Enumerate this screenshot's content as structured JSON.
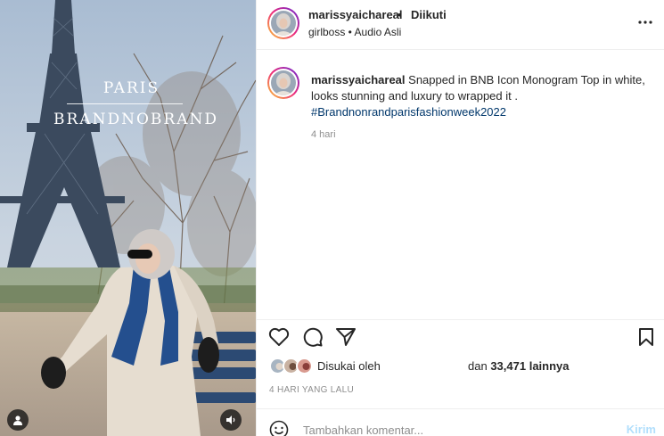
{
  "post": {
    "username": "marissyaichareal",
    "separator": "•",
    "follow_status": "Diikuti",
    "audio": "girlboss • Audio Asli",
    "more_icon": "more-horizontal-icon"
  },
  "media": {
    "overlay_city": "PARIS",
    "overlay_brand": "BRANDNOBRAND"
  },
  "caption": {
    "username": "marissyaichareal",
    "text": " Snapped in BNB Icon Monogram Top in white, looks stunning and luxury to wrapped it . ",
    "hashtag": "#Brandnonrandparisfashionweek2022",
    "time": "4 hari"
  },
  "actions": {
    "like_icon": "heart-icon",
    "comment_icon": "comment-icon",
    "share_icon": "send-icon",
    "save_icon": "bookmark-icon"
  },
  "likes": {
    "liked_by": "Disukai oleh",
    "and": "dan",
    "count": "33,471",
    "others": "lainnya"
  },
  "date": "4 HARI YANG LALU",
  "comment": {
    "placeholder": "Tambahkan komentar...",
    "post_label": "Kirim"
  },
  "colors": {
    "link": "#00376b",
    "muted": "#8e8e8e",
    "post_disabled": "#b2dffc"
  }
}
